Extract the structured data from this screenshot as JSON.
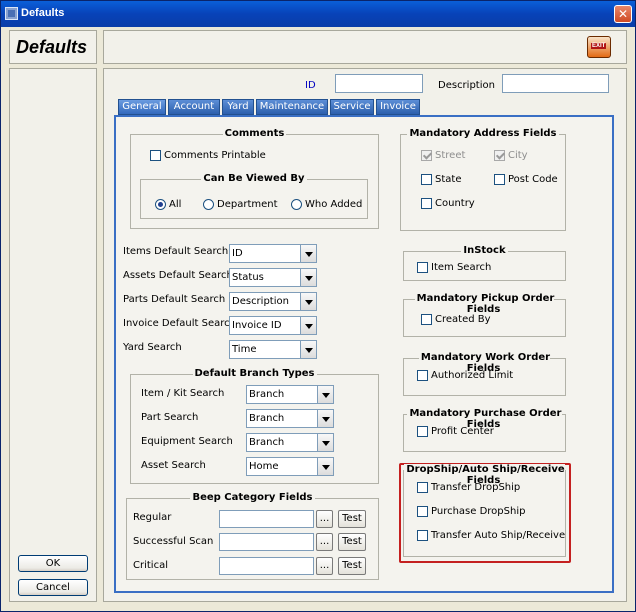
{
  "window": {
    "title": "Defaults",
    "close_glyph": "✕"
  },
  "heading": "Defaults",
  "exit_label": "EXIT",
  "buttons": {
    "ok": "OK",
    "cancel": "Cancel"
  },
  "fields": {
    "id_label": "ID",
    "id_value": "",
    "description_label": "Description",
    "description_value": ""
  },
  "tabs": [
    {
      "label": "General",
      "active": true
    },
    {
      "label": "Account"
    },
    {
      "label": "Yard"
    },
    {
      "label": "Maintenance"
    },
    {
      "label": "Service"
    },
    {
      "label": "Invoice"
    }
  ],
  "comments": {
    "title": "Comments",
    "printable": "Comments Printable",
    "viewed_by_title": "Can Be Viewed By",
    "options": [
      "All",
      "Department",
      "Who Added"
    ],
    "selected": "All"
  },
  "defaults": [
    {
      "label": "Items Default Search",
      "value": "ID"
    },
    {
      "label": "Assets Default Search",
      "value": "Status"
    },
    {
      "label": "Parts Default Search",
      "value": "Description"
    },
    {
      "label": "Invoice Default Search",
      "value": "Invoice ID"
    },
    {
      "label": "Yard Search",
      "value": "Time"
    }
  ],
  "branch_types": {
    "title": "Default Branch Types",
    "rows": [
      {
        "label": "Item / Kit Search",
        "value": "Branch"
      },
      {
        "label": "Part Search",
        "value": "Branch"
      },
      {
        "label": "Equipment Search",
        "value": "Branch"
      },
      {
        "label": "Asset Search",
        "value": "Home"
      }
    ]
  },
  "beep": {
    "title": "Beep Category Fields",
    "rows": [
      {
        "label": "Regular",
        "browse": "...",
        "test": "Test"
      },
      {
        "label": "Successful Scan",
        "browse": "...",
        "test": "Test"
      },
      {
        "label": "Critical",
        "browse": "...",
        "test": "Test"
      }
    ]
  },
  "address": {
    "title": "Mandatory Address Fields",
    "items": [
      {
        "label": "Street",
        "checked": true,
        "disabled": true
      },
      {
        "label": "City",
        "checked": true,
        "disabled": true
      },
      {
        "label": "State",
        "checked": false
      },
      {
        "label": "Post Code",
        "checked": false
      },
      {
        "label": "Country",
        "checked": false
      }
    ]
  },
  "instock": {
    "title": "InStock",
    "item": "Item Search"
  },
  "pickup": {
    "title": "Mandatory Pickup Order Fields",
    "item": "Created By"
  },
  "work": {
    "title": "Mandatory Work Order Fields",
    "item": "Authorized Limit"
  },
  "purchase": {
    "title": "Mandatory Purchase Order Fields",
    "item": "Profit Center"
  },
  "dropship": {
    "title": "DropShip/Auto Ship/Receive Fields",
    "items": [
      "Transfer DropShip",
      "Purchase DropShip",
      "Transfer Auto Ship/Receive"
    ]
  },
  "colors": {
    "titlebar": "#0a4fc8",
    "tab": "#3a6fc4",
    "highlight": "#c42020"
  }
}
